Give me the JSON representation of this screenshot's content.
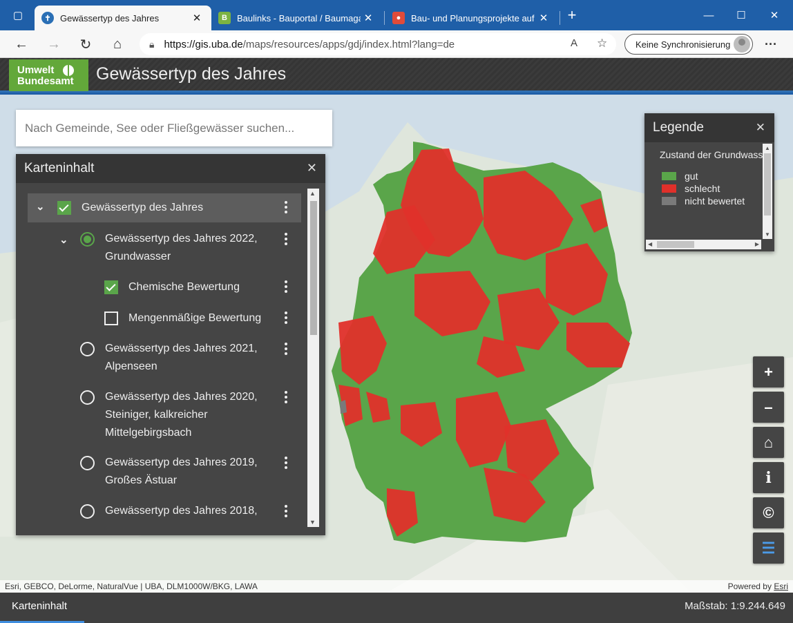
{
  "browser": {
    "tabs": [
      {
        "title": "Gewässertyp des Jahres",
        "icon": "uba-globe-icon",
        "active": true
      },
      {
        "title": "Baulinks - Bauportal / Baumagaz",
        "icon": "baulinks-b-icon",
        "active": false
      },
      {
        "title": "Bau- und Planungsprojekte auf B",
        "icon": "map-pin-icon",
        "active": false
      }
    ],
    "address": {
      "host": "https://gis.uba.de",
      "path": "/maps/resources/apps/gdj/index.html?lang=de"
    },
    "sync_label": "Keine Synchronisierung"
  },
  "app": {
    "logo_line1": "Umwelt",
    "logo_line2": "Bundesamt",
    "title": "Gewässertyp des Jahres"
  },
  "search": {
    "placeholder": "Nach Gemeinde, See oder Fließgewässer suchen..."
  },
  "toc": {
    "title": "Karteninhalt",
    "layers": [
      {
        "label": "Gewässertyp des Jahres",
        "control": "checkbox",
        "state": "checked",
        "expanded": true
      },
      {
        "label_l1": "Gewässertyp des Jahres 2022,",
        "label_l2": "Grundwasser",
        "control": "radio",
        "state": "selected",
        "expanded": true
      },
      {
        "label": "Chemische Bewertung",
        "control": "checkbox",
        "state": "checked"
      },
      {
        "label": "Mengenmäßige Bewertung",
        "control": "checkbox",
        "state": "unchecked"
      },
      {
        "label_l1": "Gewässertyp des Jahres 2021,",
        "label_l2": "Alpenseen",
        "control": "radio",
        "state": "unselected"
      },
      {
        "label_l1": "Gewässertyp des Jahres 2020,",
        "label_l2": "Steiniger, kalkreicher",
        "label_l3": "Mittelgebirgsbach",
        "control": "radio",
        "state": "unselected"
      },
      {
        "label_l1": "Gewässertyp des Jahres 2019,",
        "label_l2": "Großes Ästuar",
        "control": "radio",
        "state": "unselected"
      },
      {
        "label_l1": "Gewässertyp des Jahres 2018,",
        "control": "radio",
        "state": "unselected"
      }
    ]
  },
  "legend": {
    "title": "Legende",
    "subtitle": "Zustand der Grundwasserkörper",
    "items": [
      {
        "label": "gut",
        "color": "#5aa54a"
      },
      {
        "label": "schlecht",
        "color": "#e0302a"
      },
      {
        "label": "nicht bewertet",
        "color": "#7a7a7a"
      }
    ]
  },
  "tools": [
    {
      "label": "+",
      "name": "zoom-in"
    },
    {
      "label": "–",
      "name": "zoom-out"
    },
    {
      "label": "⌂",
      "name": "home"
    },
    {
      "label": "i",
      "name": "info"
    },
    {
      "label": "©",
      "name": "copyright"
    },
    {
      "label": "☰",
      "name": "layer-list"
    }
  ],
  "attribution": {
    "left": "Esri, GEBCO, DeLorme, NaturalVue | UBA, DLM1000W/BKG, LAWA",
    "powered": "Powered by",
    "esri": "Esri"
  },
  "footer": {
    "tab": "Karteninhalt",
    "scale": "Maßstab: 1:9.244.649"
  },
  "colors": {
    "good": "#5aa54a",
    "bad": "#e0302a",
    "unrated": "#7a7a7a",
    "accent": "#3f8ee0"
  }
}
